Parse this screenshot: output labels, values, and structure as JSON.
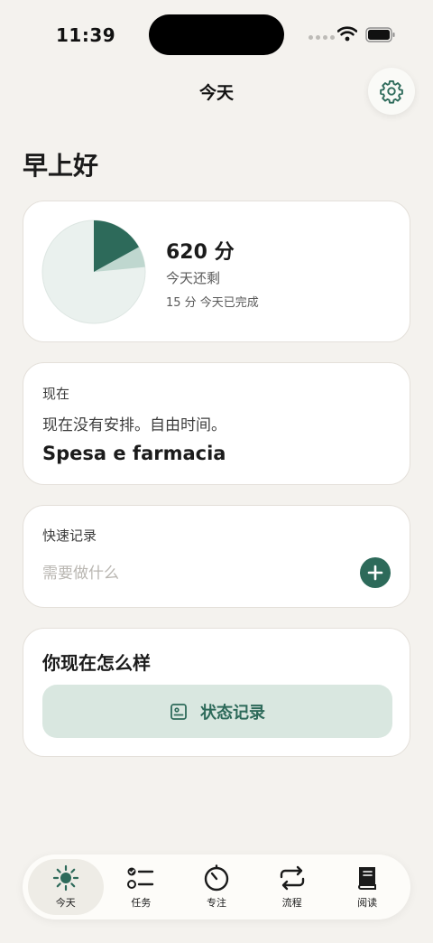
{
  "status_bar": {
    "time": "11:39"
  },
  "header": {
    "title": "今天",
    "settings_icon": "gear-icon"
  },
  "greeting": "早上好",
  "summary": {
    "minutes_left": "620 分",
    "remaining_label": "今天还剩",
    "completed_text": "15 分 今天已完成",
    "pie": {
      "total_minutes": 635,
      "completed_minutes": 15,
      "highlight_fraction": 0.17,
      "secondary_fraction": 0.065
    }
  },
  "now": {
    "label": "现在",
    "message": "现在没有安排。自由时间。",
    "task": "Spesa e farmacia"
  },
  "quick_log": {
    "label": "快速记录",
    "placeholder": "需要做什么",
    "add_icon": "plus-icon"
  },
  "mood": {
    "title": "你现在怎么样",
    "button_label": "状态记录",
    "button_icon": "journal-icon"
  },
  "tabs": [
    {
      "label": "今天",
      "icon": "sun-icon",
      "active": true
    },
    {
      "label": "任务",
      "icon": "checklist-icon",
      "active": false
    },
    {
      "label": "专注",
      "icon": "timer-icon",
      "active": false
    },
    {
      "label": "流程",
      "icon": "repeat-icon",
      "active": false
    },
    {
      "label": "阅读",
      "icon": "book-icon",
      "active": false
    }
  ],
  "colors": {
    "accent": "#2D6A5A",
    "accent_light": "#D9E7E0",
    "pie_secondary": "#BFD7CF",
    "pie_background": "#EAF1EE",
    "background": "#F4F2EE"
  }
}
